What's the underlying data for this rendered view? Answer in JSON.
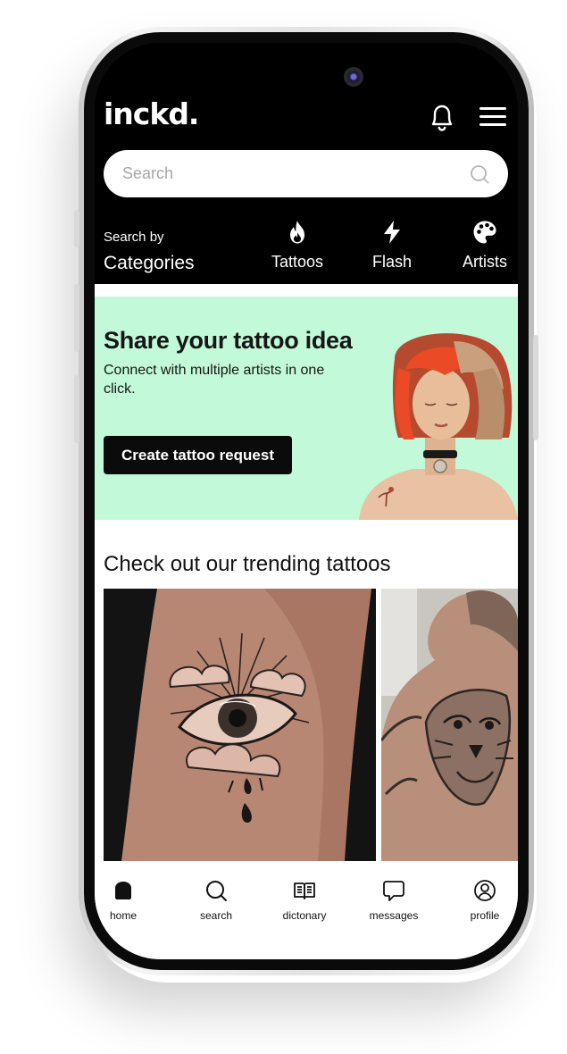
{
  "app": {
    "logo": "inckd."
  },
  "header": {
    "search_placeholder": "Search",
    "search_by_label": "Search by",
    "categories_label": "Categories",
    "categories": [
      {
        "label": "Tattoos",
        "icon": "flame-icon"
      },
      {
        "label": "Flash",
        "icon": "lightning-icon"
      },
      {
        "label": "Artists",
        "icon": "palette-icon"
      }
    ],
    "notification_icon": "bell-icon",
    "menu_icon": "hamburger-menu-icon"
  },
  "banner": {
    "title": "Share your tattoo idea",
    "subtitle": "Connect with multiple artists in one click.",
    "cta_label": "Create tattoo request",
    "background": "#c2f9d8"
  },
  "trending": {
    "title": "Check out our trending tattoos"
  },
  "bottom_nav": [
    {
      "label": "home",
      "icon": "home-icon",
      "active": true
    },
    {
      "label": "search",
      "icon": "search-icon"
    },
    {
      "label": "dictonary",
      "icon": "book-icon"
    },
    {
      "label": "messages",
      "icon": "chat-bubble-icon"
    },
    {
      "label": "profile",
      "icon": "user-circle-icon"
    }
  ],
  "colors": {
    "header_bg": "#000000",
    "accent_green": "#c2f9d8",
    "button_bg": "#0b0b0b"
  }
}
